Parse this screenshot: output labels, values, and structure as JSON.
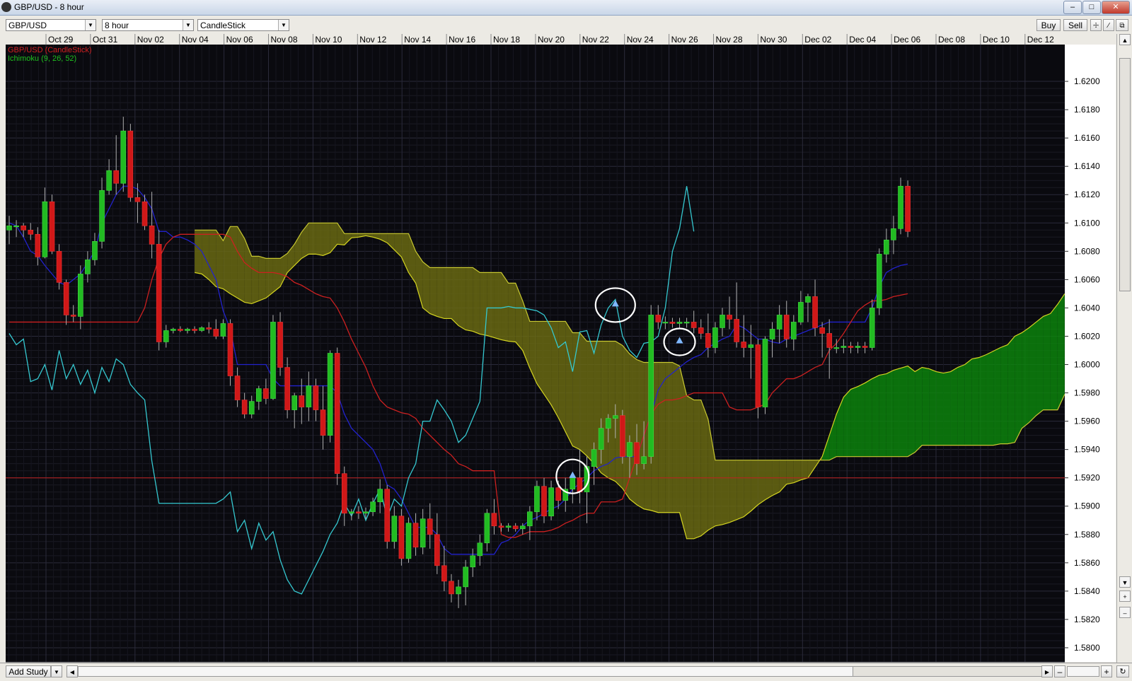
{
  "window": {
    "title": "GBP/USD - 8 hour"
  },
  "toolbar": {
    "symbol": "GBP/USD",
    "interval": "8 hour",
    "chart_style": "CandleStick",
    "buy_label": "Buy",
    "sell_label": "Sell"
  },
  "footer": {
    "add_study_label": "Add Study"
  },
  "colors": {
    "background": "#0a0a0f",
    "grid": "#2a2a3a",
    "bull": "#22bb22",
    "bear": "#d01818",
    "tenkan": "#2222cc",
    "kijun": "#cc2020",
    "chikou": "#35c8d0",
    "cloud_bull": "#0b8a0b",
    "cloud_bear": "#6e6e12",
    "span_a": "#d4d420",
    "span_b": "#c8c830"
  },
  "chart_data": {
    "type": "candlestick",
    "legend": [
      "GBP/USD (CandleStick)",
      "Ichimoku (9, 26, 52)"
    ],
    "x_labels": [
      "Oct 29",
      "Oct 31",
      "Nov 02",
      "Nov 04",
      "Nov 06",
      "Nov 08",
      "Nov 10",
      "Nov 12",
      "Nov 14",
      "Nov 16",
      "Nov 18",
      "Nov 20",
      "Nov 22",
      "Nov 24",
      "Nov 26",
      "Nov 28",
      "Nov 30",
      "Dec 02",
      "Dec 04",
      "Dec 06",
      "Dec 08",
      "Dec 10",
      "Dec 12"
    ],
    "y_ticks": [
      "1.6200",
      "1.6180",
      "1.6160",
      "1.6140",
      "1.6120",
      "1.6100",
      "1.6080",
      "1.6060",
      "1.6040",
      "1.6020",
      "1.6000",
      "1.5980",
      "1.5960",
      "1.5940",
      "1.5920",
      "1.5900",
      "1.5880",
      "1.5860",
      "1.5840",
      "1.5820",
      "1.5800"
    ],
    "ylim": [
      1.579,
      1.6226
    ],
    "current_price": 1.592,
    "candles_ohlc": [
      [
        1.6095,
        1.6105,
        1.6085,
        1.6098
      ],
      [
        1.6098,
        1.6102,
        1.609,
        1.6098
      ],
      [
        1.6098,
        1.61,
        1.609,
        1.6095
      ],
      [
        1.6095,
        1.61,
        1.6088,
        1.6092
      ],
      [
        1.6092,
        1.6097,
        1.607,
        1.6076
      ],
      [
        1.6076,
        1.6125,
        1.6075,
        1.6115
      ],
      [
        1.6115,
        1.612,
        1.6078,
        1.608
      ],
      [
        1.608,
        1.6085,
        1.6053,
        1.6058
      ],
      [
        1.6058,
        1.606,
        1.6028,
        1.6035
      ],
      [
        1.6035,
        1.6042,
        1.603,
        1.6034
      ],
      [
        1.6034,
        1.607,
        1.6025,
        1.6064
      ],
      [
        1.6064,
        1.608,
        1.6058,
        1.6074
      ],
      [
        1.6074,
        1.6093,
        1.607,
        1.6087
      ],
      [
        1.6087,
        1.6132,
        1.6082,
        1.6123
      ],
      [
        1.6123,
        1.6145,
        1.612,
        1.6137
      ],
      [
        1.6137,
        1.6162,
        1.612,
        1.6128
      ],
      [
        1.6128,
        1.6175,
        1.6122,
        1.6165
      ],
      [
        1.6165,
        1.617,
        1.6115,
        1.6118
      ],
      [
        1.6118,
        1.6128,
        1.61,
        1.6115
      ],
      [
        1.6115,
        1.612,
        1.6095,
        1.6098
      ],
      [
        1.6098,
        1.6122,
        1.6075,
        1.6085
      ],
      [
        1.6085,
        1.6095,
        1.601,
        1.6016
      ],
      [
        1.6016,
        1.6028,
        1.6012,
        1.6024
      ],
      [
        1.6024,
        1.6026,
        1.6022,
        1.6025
      ],
      [
        1.6025,
        1.6027,
        1.6023,
        1.6024
      ],
      [
        1.6024,
        1.6026,
        1.6022,
        1.6025
      ],
      [
        1.6025,
        1.6027,
        1.6022,
        1.6024
      ],
      [
        1.6024,
        1.6027,
        1.6023,
        1.6026
      ],
      [
        1.6026,
        1.603,
        1.6022,
        1.6025
      ],
      [
        1.6025,
        1.6032,
        1.6018,
        1.602
      ],
      [
        1.602,
        1.6032,
        1.6018,
        1.6029
      ],
      [
        1.6029,
        1.6032,
        1.5985,
        1.5992
      ],
      [
        1.5992,
        1.5998,
        1.597,
        1.5975
      ],
      [
        1.5975,
        1.598,
        1.5962,
        1.5965
      ],
      [
        1.5965,
        1.5978,
        1.5962,
        1.5974
      ],
      [
        1.5974,
        1.5985,
        1.5968,
        1.5983
      ],
      [
        1.5983,
        1.599,
        1.5972,
        1.5976
      ],
      [
        1.5976,
        1.6035,
        1.5975,
        1.603
      ],
      [
        1.603,
        1.6037,
        1.5992,
        1.5998
      ],
      [
        1.5998,
        1.6005,
        1.5962,
        1.5968
      ],
      [
        1.5968,
        1.598,
        1.5955,
        1.5978
      ],
      [
        1.5978,
        1.599,
        1.5958,
        1.597
      ],
      [
        1.597,
        1.5995,
        1.596,
        1.5985
      ],
      [
        1.5985,
        1.599,
        1.596,
        1.5968
      ],
      [
        1.5968,
        1.5985,
        1.594,
        1.595
      ],
      [
        1.595,
        1.601,
        1.5945,
        1.6008
      ],
      [
        1.6008,
        1.6012,
        1.5915,
        1.5923
      ],
      [
        1.5923,
        1.5928,
        1.5886,
        1.5895
      ],
      [
        1.5895,
        1.5898,
        1.589,
        1.5896
      ],
      [
        1.5896,
        1.59,
        1.5891,
        1.5895
      ],
      [
        1.5895,
        1.5899,
        1.5891,
        1.5896
      ],
      [
        1.5896,
        1.5906,
        1.5893,
        1.5903
      ],
      [
        1.5903,
        1.5919,
        1.5895,
        1.5912
      ],
      [
        1.5912,
        1.5915,
        1.587,
        1.5875
      ],
      [
        1.5875,
        1.59,
        1.587,
        1.5893
      ],
      [
        1.5893,
        1.5898,
        1.5858,
        1.5863
      ],
      [
        1.5863,
        1.5892,
        1.586,
        1.5888
      ],
      [
        1.5888,
        1.5895,
        1.5865,
        1.5871
      ],
      [
        1.5871,
        1.5898,
        1.5866,
        1.5891
      ],
      [
        1.5891,
        1.5902,
        1.587,
        1.588
      ],
      [
        1.588,
        1.5895,
        1.5852,
        1.5858
      ],
      [
        1.5858,
        1.5872,
        1.584,
        1.5847
      ],
      [
        1.5847,
        1.5852,
        1.5832,
        1.5838
      ],
      [
        1.5838,
        1.5848,
        1.5828,
        1.5843
      ],
      [
        1.5843,
        1.5862,
        1.583,
        1.5857
      ],
      [
        1.5857,
        1.587,
        1.585,
        1.5865
      ],
      [
        1.5865,
        1.588,
        1.5858,
        1.5874
      ],
      [
        1.5874,
        1.5898,
        1.5868,
        1.5895
      ],
      [
        1.5895,
        1.5905,
        1.588,
        1.5886
      ],
      [
        1.5886,
        1.5888,
        1.5882,
        1.5885
      ],
      [
        1.5885,
        1.5888,
        1.5882,
        1.5886
      ],
      [
        1.5886,
        1.5888,
        1.5882,
        1.5884
      ],
      [
        1.5884,
        1.5888,
        1.588,
        1.5886
      ],
      [
        1.5886,
        1.59,
        1.5876,
        1.5896
      ],
      [
        1.5896,
        1.5918,
        1.589,
        1.5914
      ],
      [
        1.5914,
        1.592,
        1.5888,
        1.5893
      ],
      [
        1.5893,
        1.5918,
        1.589,
        1.5913
      ],
      [
        1.5913,
        1.5918,
        1.5898,
        1.5904
      ],
      [
        1.5904,
        1.592,
        1.5896,
        1.5912
      ],
      [
        1.5912,
        1.5922,
        1.5902,
        1.592
      ],
      [
        1.592,
        1.594,
        1.5902,
        1.591
      ],
      [
        1.591,
        1.5935,
        1.5888,
        1.5928
      ],
      [
        1.5928,
        1.5945,
        1.5915,
        1.594
      ],
      [
        1.594,
        1.5962,
        1.593,
        1.5955
      ],
      [
        1.5955,
        1.5965,
        1.5945,
        1.5962
      ],
      [
        1.5962,
        1.5972,
        1.5948,
        1.5964
      ],
      [
        1.5964,
        1.5968,
        1.593,
        1.5935
      ],
      [
        1.5935,
        1.595,
        1.592,
        1.5945
      ],
      [
        1.5945,
        1.5958,
        1.5922,
        1.593
      ],
      [
        1.593,
        1.596,
        1.5926,
        1.5935
      ],
      [
        1.5935,
        1.6042,
        1.593,
        1.6035
      ],
      [
        1.6035,
        1.6042,
        1.6025,
        1.603
      ],
      [
        1.603,
        1.6034,
        1.6025,
        1.603
      ],
      [
        1.603,
        1.6033,
        1.6026,
        1.6029
      ],
      [
        1.6029,
        1.6033,
        1.6026,
        1.603
      ],
      [
        1.603,
        1.6033,
        1.6026,
        1.603
      ],
      [
        1.603,
        1.6038,
        1.6022,
        1.6026
      ],
      [
        1.6026,
        1.6032,
        1.6018,
        1.6022
      ],
      [
        1.6022,
        1.6036,
        1.6005,
        1.6012
      ],
      [
        1.6012,
        1.603,
        1.6008,
        1.6026
      ],
      [
        1.6026,
        1.604,
        1.602,
        1.6035
      ],
      [
        1.6035,
        1.6048,
        1.6025,
        1.6032
      ],
      [
        1.6032,
        1.6058,
        1.6012,
        1.6016
      ],
      [
        1.6016,
        1.6035,
        1.6005,
        1.6012
      ],
      [
        1.6012,
        1.6028,
        1.599,
        1.6014
      ],
      [
        1.6014,
        1.6018,
        1.5962,
        1.597
      ],
      [
        1.597,
        1.602,
        1.5965,
        1.6018
      ],
      [
        1.6018,
        1.603,
        1.6005,
        1.6025
      ],
      [
        1.6025,
        1.6042,
        1.6015,
        1.6035
      ],
      [
        1.6035,
        1.6045,
        1.6012,
        1.6018
      ],
      [
        1.6018,
        1.6035,
        1.601,
        1.603
      ],
      [
        1.603,
        1.6052,
        1.6028,
        1.6044
      ],
      [
        1.6044,
        1.605,
        1.603,
        1.6048
      ],
      [
        1.6048,
        1.606,
        1.602,
        1.6026
      ],
      [
        1.6026,
        1.603,
        1.6005,
        1.6022
      ],
      [
        1.6022,
        1.6032,
        1.599,
        1.6012
      ],
      [
        1.6012,
        1.6018,
        1.6008,
        1.6012
      ],
      [
        1.6012,
        1.6018,
        1.6008,
        1.6013
      ],
      [
        1.6013,
        1.6016,
        1.6008,
        1.6012
      ],
      [
        1.6012,
        1.6016,
        1.6008,
        1.6013
      ],
      [
        1.6013,
        1.6016,
        1.6008,
        1.6012
      ],
      [
        1.6012,
        1.6046,
        1.601,
        1.604
      ],
      [
        1.604,
        1.6082,
        1.6035,
        1.6078
      ],
      [
        1.6078,
        1.6096,
        1.6072,
        1.6088
      ],
      [
        1.6088,
        1.6105,
        1.6078,
        1.6096
      ],
      [
        1.6096,
        1.6132,
        1.6092,
        1.6126
      ],
      [
        1.6126,
        1.613,
        1.609,
        1.6094
      ]
    ],
    "tenkan": [
      1.61,
      1.6098,
      1.609,
      1.608,
      1.6077,
      1.607,
      1.6064,
      1.6058,
      1.6056,
      1.606,
      1.6064,
      1.6072,
      1.608,
      1.61,
      1.611,
      1.612,
      1.6126,
      1.6126,
      1.6124,
      1.6118,
      1.611,
      1.6094,
      1.6094,
      1.609,
      1.609,
      1.6088,
      1.6085,
      1.608,
      1.607,
      1.606,
      1.6038,
      1.6025,
      1.6,
      1.6,
      1.6,
      1.6,
      1.6,
      1.599,
      1.5985,
      1.5985,
      1.5985,
      1.5985,
      1.5985,
      1.5985,
      1.5985,
      1.5985,
      1.598,
      1.5965,
      1.5955,
      1.595,
      1.5945,
      1.594,
      1.593,
      1.5915,
      1.5912,
      1.5905,
      1.5895,
      1.5885,
      1.5885,
      1.5885,
      1.588,
      1.587,
      1.5866,
      1.5866,
      1.5866,
      1.5866,
      1.5866,
      1.5866,
      1.5866,
      1.5874,
      1.5876,
      1.588,
      1.5886,
      1.589,
      1.5892,
      1.5895,
      1.5898,
      1.59,
      1.5905,
      1.5912,
      1.5916,
      1.592,
      1.5925,
      1.5928,
      1.593,
      1.5934,
      1.5935,
      1.5935,
      1.5935,
      1.595,
      1.5965,
      1.5982,
      1.599,
      1.5994,
      1.5998,
      1.6002,
      1.6005,
      1.6007,
      1.6012,
      1.6015,
      1.6018,
      1.602,
      1.6028,
      1.6026,
      1.6022,
      1.6018,
      1.6018,
      1.6016,
      1.6015,
      1.6018,
      1.602,
      1.6022,
      1.6024,
      1.6026,
      1.6028,
      1.603,
      1.603,
      1.603,
      1.603,
      1.603,
      1.603,
      1.604,
      1.6055,
      1.6065,
      1.6068,
      1.607,
      1.6071
    ],
    "kijun": [
      1.603,
      1.603,
      1.603,
      1.603,
      1.603,
      1.603,
      1.603,
      1.603,
      1.603,
      1.603,
      1.603,
      1.603,
      1.603,
      1.603,
      1.603,
      1.603,
      1.603,
      1.603,
      1.603,
      1.604,
      1.606,
      1.6075,
      1.6085,
      1.609,
      1.6092,
      1.6092,
      1.6092,
      1.6092,
      1.6092,
      1.6092,
      1.6092,
      1.609,
      1.608,
      1.6072,
      1.6068,
      1.6065,
      1.6065,
      1.6065,
      1.6064,
      1.6062,
      1.6058,
      1.6056,
      1.6053,
      1.605,
      1.6048,
      1.6047,
      1.604,
      1.603,
      1.6018,
      1.6008,
      1.5998,
      1.5985,
      1.5975,
      1.597,
      1.5968,
      1.5966,
      1.5965,
      1.5962,
      1.5955,
      1.595,
      1.5945,
      1.594,
      1.5936,
      1.593,
      1.5928,
      1.5925,
      1.5925,
      1.5925,
      1.5925,
      1.588,
      1.5878,
      1.5878,
      1.588,
      1.5882,
      1.5882,
      1.5882,
      1.5883,
      1.5885,
      1.5888,
      1.589,
      1.5893,
      1.5895,
      1.5895,
      1.5903,
      1.5903,
      1.5903,
      1.5905,
      1.592,
      1.5935,
      1.595,
      1.5965,
      1.5972,
      1.5975,
      1.5975,
      1.5976,
      1.5978,
      1.598,
      1.598,
      1.598,
      1.598,
      1.598,
      1.597,
      1.5968,
      1.5968,
      1.5968,
      1.597,
      1.5972,
      1.598,
      1.5985,
      1.599,
      1.599,
      1.5992,
      1.5995,
      1.5998,
      1.6,
      1.601,
      1.6015,
      1.6022,
      1.603,
      1.6038,
      1.6042,
      1.6045,
      1.6045,
      1.6046,
      1.6048,
      1.6049,
      1.605
    ],
    "chikou": [
      1.6022,
      1.6014,
      1.6018,
      1.5988,
      1.599,
      1.6,
      1.5982,
      1.601,
      1.599,
      1.6,
      1.5986,
      1.5996,
      1.598,
      1.5998,
      1.5988,
      1.6004,
      1.6,
      1.5986,
      1.598,
      1.5975,
      1.5932,
      1.5902,
      1.5902,
      1.5902,
      1.5902,
      1.5902,
      1.5902,
      1.5902,
      1.5902,
      1.5902,
      1.5905,
      1.591,
      1.5882,
      1.589,
      1.587,
      1.5888,
      1.5876,
      1.5882,
      1.5862,
      1.5848,
      1.584,
      1.5838,
      1.5848,
      1.5858,
      1.5868,
      1.588,
      1.5888,
      1.5902,
      1.5893,
      1.5905,
      1.589,
      1.5902,
      1.5912,
      1.5892,
      1.5905,
      1.59,
      1.592,
      1.593,
      1.596,
      1.596,
      1.5975,
      1.5968,
      1.596,
      1.5945,
      1.595,
      1.5962,
      1.5974,
      1.604,
      1.604,
      1.604,
      1.6041,
      1.604,
      1.604,
      1.6039,
      1.6038,
      1.6035,
      1.6026,
      1.6012,
      1.6016,
      1.5995,
      1.6023,
      1.6024,
      1.6008,
      1.6028,
      1.604,
      1.6046,
      1.602,
      1.601,
      1.6005,
      1.6015,
      1.6016,
      1.602,
      1.604,
      1.608,
      1.6096,
      1.6126,
      1.6094
    ]
  }
}
